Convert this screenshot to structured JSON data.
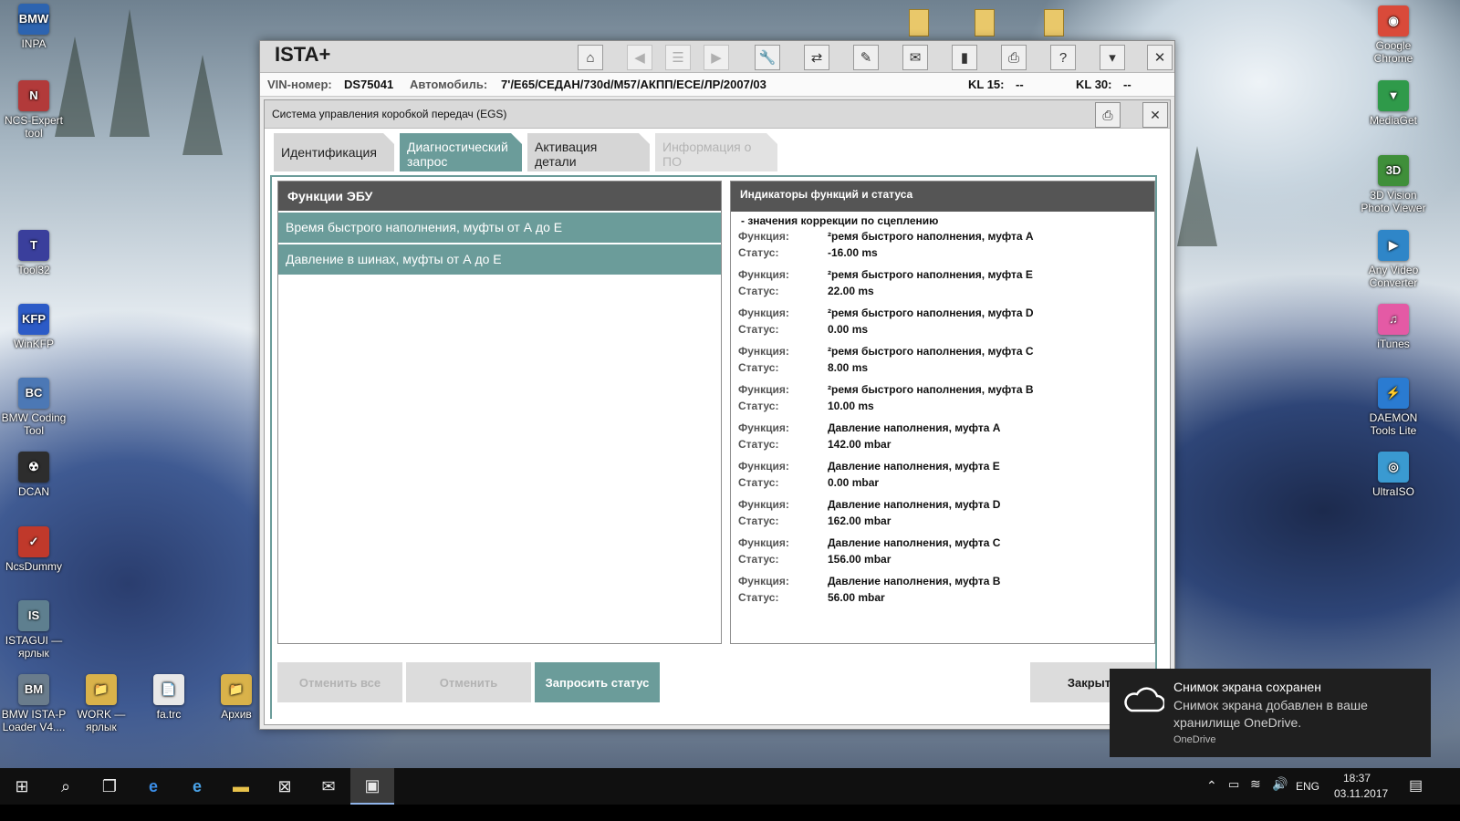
{
  "desktop": {
    "left_icons": [
      {
        "label": "INPA",
        "glyph": "BMW",
        "color": "#2d64b0"
      },
      {
        "label": "NCS-Expert tool",
        "glyph": "N",
        "color": "#b23a3a"
      },
      {
        "label": "Tool32",
        "glyph": "T",
        "color": "#3a3f9c"
      },
      {
        "label": "WinKFP",
        "glyph": "KFP",
        "color": "#2c5bc7"
      },
      {
        "label": "BMW Coding Tool",
        "glyph": "BC",
        "color": "#4c78b5"
      },
      {
        "label": "DCAN",
        "glyph": "☢",
        "color": "#2d2d2d"
      },
      {
        "label": "NcsDummy",
        "glyph": "✓",
        "color": "#c0392b"
      },
      {
        "label": "ISTAGUI — ярлык",
        "glyph": "IS",
        "color": "#5e7f8f"
      },
      {
        "label": "BMW ISTA-P Loader V4....",
        "glyph": "BM",
        "color": "#6a7c8c"
      },
      {
        "label": "WORK — ярлык",
        "glyph": "📁",
        "color": "#d9b24a"
      },
      {
        "label": "fa.trc",
        "glyph": "📄",
        "color": "#e8e8e8"
      },
      {
        "label": "Архив",
        "glyph": "📁",
        "color": "#d9b24a"
      }
    ],
    "right_icons": [
      {
        "label": "Google Chrome",
        "glyph": "◉",
        "color": "#d94a3a"
      },
      {
        "label": "MediaGet",
        "glyph": "▼",
        "color": "#2f9a4a"
      },
      {
        "label": "3D Vision Photo Viewer",
        "glyph": "3D",
        "color": "#3f8f3a"
      },
      {
        "label": "Any Video Converter",
        "glyph": "▶",
        "color": "#2f86c8"
      },
      {
        "label": "iTunes",
        "glyph": "♫",
        "color": "#e45aa5"
      },
      {
        "label": "DAEMON Tools Lite",
        "glyph": "⚡",
        "color": "#2a7bd1"
      },
      {
        "label": "UltraISO",
        "glyph": "◎",
        "color": "#3a9ad1"
      }
    ]
  },
  "ista": {
    "app_title": "ISTA+",
    "toolbar_icons": [
      "home-icon",
      "back-icon",
      "list-icon",
      "forward-icon",
      "wrench-icon",
      "compare-icon",
      "pen-icon",
      "mail-icon",
      "battery-icon",
      "printer-icon",
      "help-icon",
      "dropdown-icon",
      "close-icon"
    ],
    "vin_label": "VIN-номер:",
    "vin_value": "DS75041",
    "vehicle_label": "Автомобиль:",
    "vehicle_value": "7'/E65/СЕДАН/730d/M57/АКПП/ЕСЕ/ЛР/2007/03",
    "kl15_label": "KL 15:",
    "kl15_value": "--",
    "kl30_label": "KL 30:",
    "kl30_value": "--",
    "dialog": {
      "title": "Система управления коробкой передач (EGS)",
      "tabs": [
        {
          "label_line1": "Идентификация",
          "label_line2": "",
          "state": "normal"
        },
        {
          "label_line1": "Диагностический",
          "label_line2": "запрос",
          "state": "active"
        },
        {
          "label_line1": "Активация",
          "label_line2": "детали",
          "state": "normal"
        },
        {
          "label_line1": "Информация о",
          "label_line2": "ПО",
          "state": "disabled"
        }
      ],
      "functions_header": "Функции ЭБУ",
      "functions": [
        "Время быстрого наполнения, муфты от А до Е",
        "Давление в шинах, муфты от А до Е"
      ],
      "indicators_header": "Индикаторы функций и статуса",
      "results_caption": "- значения коррекции по сцеплению",
      "function_key": "Функция:",
      "status_key": "Статус:",
      "results": [
        {
          "function": "²ремя быстрого наполнения, муфта A",
          "status": "-16.00  ms"
        },
        {
          "function": "²ремя быстрого наполнения, муфта E",
          "status": "22.00  ms"
        },
        {
          "function": "²ремя быстрого наполнения, муфта D",
          "status": "0.00  ms"
        },
        {
          "function": "²ремя быстрого наполнения, муфта C",
          "status": "8.00  ms"
        },
        {
          "function": "²ремя быстрого наполнения, муфта B",
          "status": "10.00  ms"
        },
        {
          "function": "Давление наполнения, муфта A",
          "status": "142.00  mbar"
        },
        {
          "function": "Давление наполнения, муфта E",
          "status": "0.00  mbar"
        },
        {
          "function": "Давление наполнения, муфта D",
          "status": "162.00  mbar"
        },
        {
          "function": "Давление наполнения, муфта C",
          "status": "156.00  mbar"
        },
        {
          "function": "Давление наполнения, муфта B",
          "status": "56.00  mbar"
        }
      ],
      "buttons": {
        "cancel_all": "Отменить все",
        "cancel": "Отменить",
        "request_status": "Запросить статус",
        "close": "Закрыть"
      }
    }
  },
  "toast": {
    "title": "Снимок экрана сохранен",
    "body": "Снимок экрана добавлен в ваше хранилище OneDrive.",
    "source": "OneDrive"
  },
  "taskbar": {
    "language": "ENG",
    "time": "18:37",
    "date": "03.11.2017"
  }
}
